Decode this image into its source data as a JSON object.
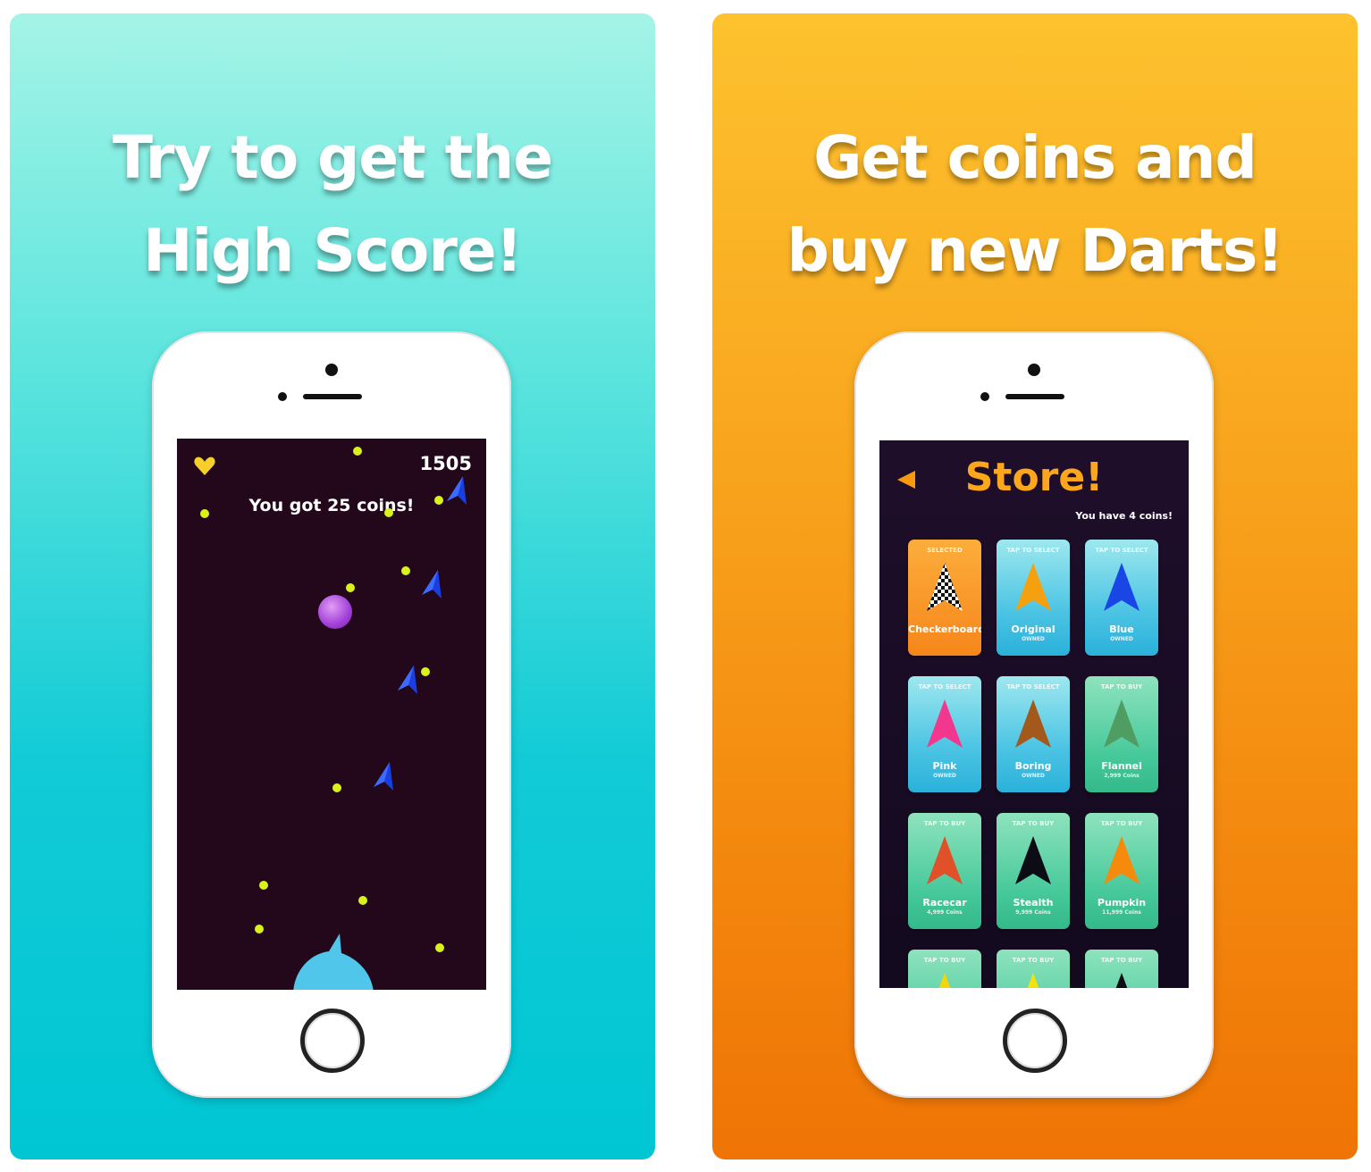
{
  "left_panel": {
    "headline_line1": "Try to get the",
    "headline_line2": "High Score!",
    "game": {
      "score": "1505",
      "message": "You got 25 coins!",
      "icons": {
        "lives": "heart-icon",
        "player": "dart-launcher-icon",
        "enemy": "blue-dart-icon",
        "orb": "purple-ball-icon",
        "coin": "coin-dot-icon"
      }
    }
  },
  "right_panel": {
    "headline_line1": "Get coins and",
    "headline_line2": "buy new Darts!",
    "store": {
      "title": "Store!",
      "coins_text": "You have 4 coins!",
      "back_icon": "back-arrow-icon",
      "items": [
        {
          "top": "SELECTED",
          "name": "Checkerboard",
          "sub": "",
          "style": "orange",
          "dart_color": "checker"
        },
        {
          "top": "TAP TO SELECT",
          "name": "Original",
          "sub": "OWNED",
          "style": "blue",
          "dart_color": "#f5a10f"
        },
        {
          "top": "TAP TO SELECT",
          "name": "Blue",
          "sub": "OWNED",
          "style": "blue",
          "dart_color": "#1a46e6"
        },
        {
          "top": "TAP TO SELECT",
          "name": "Pink",
          "sub": "OWNED",
          "style": "blue",
          "dart_color": "#f2388e"
        },
        {
          "top": "TAP TO SELECT",
          "name": "Boring",
          "sub": "OWNED",
          "style": "blue",
          "dart_color": "#a3591b"
        },
        {
          "top": "TAP TO BUY",
          "name": "Flannel",
          "sub": "2,999 Coins",
          "style": "green",
          "dart_color": "#4f9d62"
        },
        {
          "top": "TAP TO BUY",
          "name": "Racecar",
          "sub": "4,999 Coins",
          "style": "green",
          "dart_color": "#e0512a"
        },
        {
          "top": "TAP TO BUY",
          "name": "Stealth",
          "sub": "9,999 Coins",
          "style": "green",
          "dart_color": "#0c0c14"
        },
        {
          "top": "TAP TO BUY",
          "name": "Pumpkin",
          "sub": "11,999 Coins",
          "style": "green",
          "dart_color": "#f58a0c"
        },
        {
          "top": "TAP TO BUY",
          "name": "",
          "sub": "",
          "style": "green",
          "dart_color": "#f5d60c"
        },
        {
          "top": "TAP TO BUY",
          "name": "",
          "sub": "",
          "style": "green",
          "dart_color": "#f5e20c"
        },
        {
          "top": "TAP TO BUY",
          "name": "",
          "sub": "",
          "style": "green",
          "dart_color": "#0c0c14"
        }
      ]
    }
  }
}
